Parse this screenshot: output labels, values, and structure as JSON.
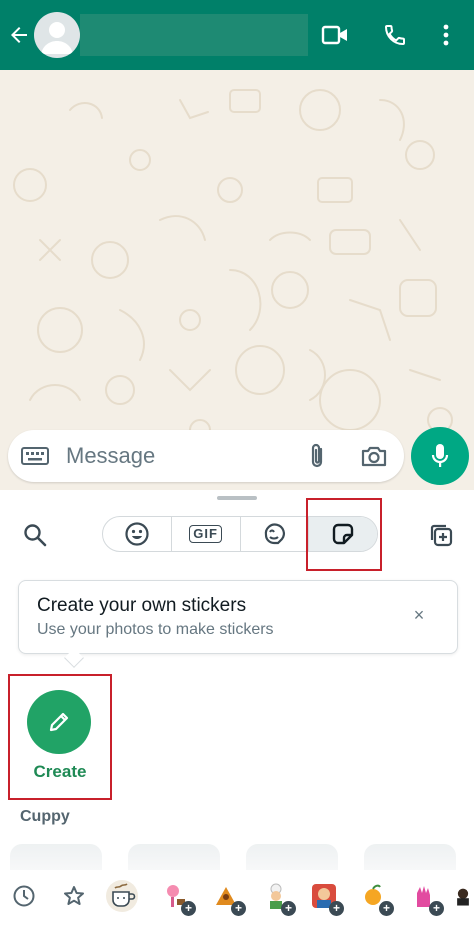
{
  "header": {
    "back_icon": "arrow-left-icon",
    "video_icon": "video-camera-icon",
    "call_icon": "phone-icon",
    "menu_icon": "more-vertical-icon",
    "color": "#008069"
  },
  "composer": {
    "placeholder": "Message",
    "mic_color": "#00a884"
  },
  "tabs": [
    {
      "id": "emoji",
      "icon": "emoji-icon"
    },
    {
      "id": "gif",
      "label": "GIF"
    },
    {
      "id": "avatar",
      "icon": "avatar-sticker-icon"
    },
    {
      "id": "stickers",
      "icon": "sticker-icon",
      "selected": true
    }
  ],
  "tooltip": {
    "title": "Create your own stickers",
    "subtitle": "Use your photos to make stickers",
    "close": "×"
  },
  "create": {
    "label": "Create",
    "color": "#21a366"
  },
  "section": {
    "title": "Cuppy"
  },
  "tray": {
    "icons": [
      "recent-clock-icon",
      "favorites-star-icon",
      "cuppy-pack-icon",
      "pack-plus-icon"
    ]
  },
  "annotation_color": "#c8202b"
}
